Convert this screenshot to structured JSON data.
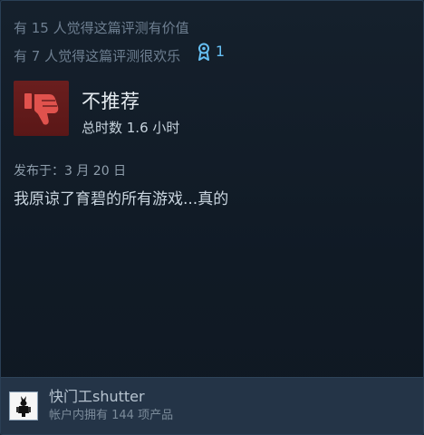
{
  "helpful": {
    "helpful_text": "有 15 人觉得这篇评测有价值",
    "funny_text": "有 7 人觉得这篇评测很欢乐",
    "award_count": "1"
  },
  "review": {
    "verdict": "不推荐",
    "hours": "总时数 1.6 小时",
    "posted": "发布于：3 月 20 日",
    "body": "我原谅了育碧的所有游戏...真的"
  },
  "author": {
    "name": "快门工shutter",
    "products": "帐户内拥有 144 项产品"
  },
  "colors": {
    "thumb_bg": "#6a1e1e",
    "thumb_icon": "#e0524d",
    "award": "#66c0f4"
  }
}
